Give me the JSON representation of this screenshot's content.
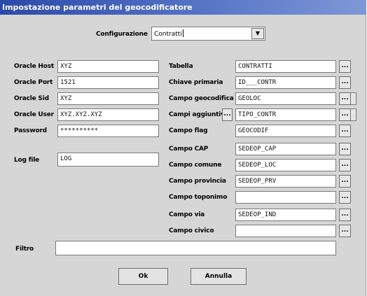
{
  "window": {
    "title": "Impostazione parametri del geocodificatore"
  },
  "config": {
    "label": "Configurazione",
    "value": "Contratti",
    "arrow": "▼"
  },
  "left": {
    "oracle_host": {
      "label": "Oracle Host",
      "value": "XYZ"
    },
    "oracle_port": {
      "label": "Oracle Port",
      "value": "1521"
    },
    "oracle_sid": {
      "label": "Oracle Sid",
      "value": "XYZ"
    },
    "oracle_user": {
      "label": "Oracle User",
      "value": "XYZ.XYZ.XYZ"
    },
    "password": {
      "label": "Password",
      "value": "**********"
    },
    "log_file": {
      "label": "Log file",
      "value": "LOG"
    }
  },
  "right": {
    "tabella": {
      "label": "Tabella",
      "value": "CONTRATTI"
    },
    "chiave_primaria": {
      "label": "Chiave primaria",
      "value": "ID___CONTR"
    },
    "campo_geocodifica": {
      "label": "Campo geocodifica",
      "value": "GEOLOC"
    },
    "campi_aggiuntivi": {
      "label": "Campi aggiuntivi",
      "value": "TIPO_CONTR"
    },
    "campo_flag": {
      "label": "Campo flag",
      "value": "GEOCODIF"
    },
    "campo_cap": {
      "label": "Campo CAP",
      "value": "SEDEOP_CAP"
    },
    "campo_comune": {
      "label": "Campo comune",
      "value": "SEDEOP_LOC"
    },
    "campo_provincia": {
      "label": "Campo provincia",
      "value": "SEDEOP_PRV"
    },
    "campo_toponimo": {
      "label": "Campo toponimo",
      "value": ""
    },
    "campo_via": {
      "label": "Campo via",
      "value": "SEDEOP_IND"
    },
    "campo_civico": {
      "label": "Campo civico",
      "value": ""
    },
    "browse_label": "..."
  },
  "filtro": {
    "label": "Filtro",
    "value": ""
  },
  "buttons": {
    "ok": "Ok",
    "annulla": "Annulla"
  }
}
